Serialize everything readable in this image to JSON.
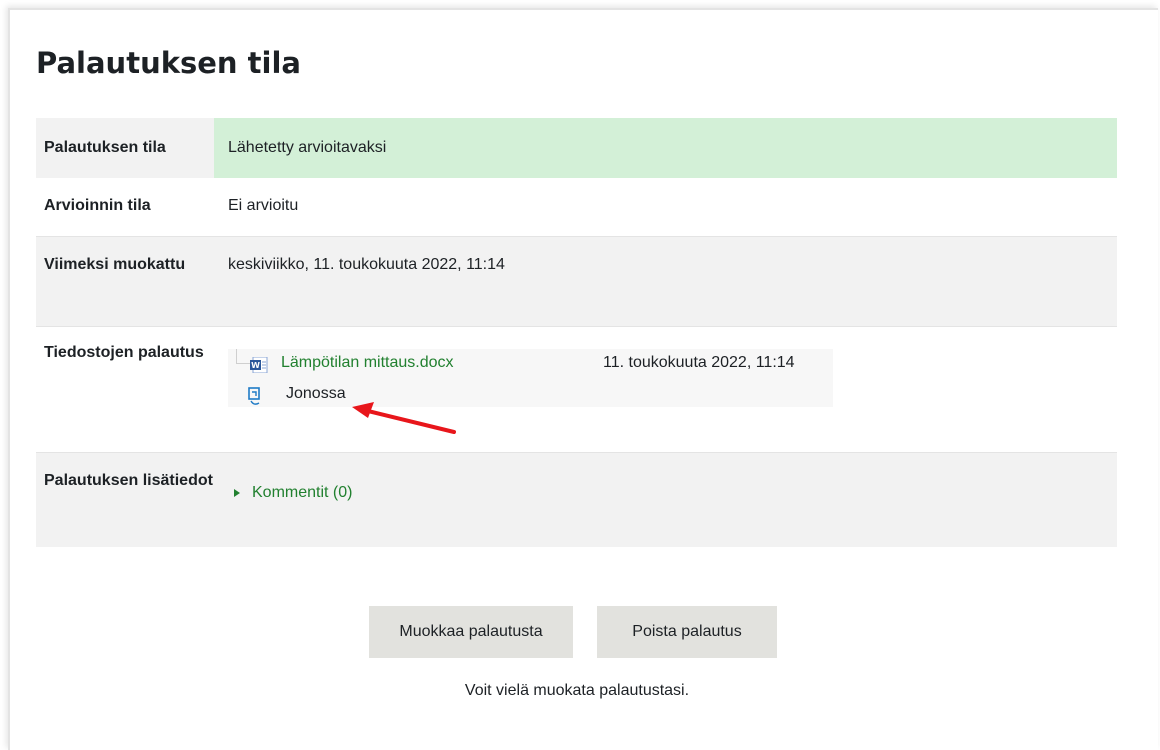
{
  "heading": "Palautuksen tila",
  "rows": {
    "submission_status": {
      "label": "Palautuksen tila",
      "value": "Lähetetty arvioitavaksi"
    },
    "grading_status": {
      "label": "Arvioinnin tila",
      "value": "Ei arvioitu"
    },
    "last_modified": {
      "label": "Viimeksi muokattu",
      "value": "keskiviikko, 11. toukokuuta 2022, 11:14"
    },
    "file_submissions": {
      "label": "Tiedostojen palautus",
      "file": {
        "name": "Lämpötilan mittaus.docx",
        "date": "11. toukokuuta 2022, 11:14",
        "icon": "word-file-icon"
      },
      "queue": {
        "label": "Jonossa",
        "icon": "queue-icon"
      }
    },
    "submission_comments": {
      "label": "Palautuksen lisätiedot",
      "link": "Kommentit (0)"
    }
  },
  "buttons": {
    "edit": "Muokkaa palautusta",
    "remove": "Poista palautus"
  },
  "hint": "Voit vielä muokata palautustasi.",
  "colors": {
    "success_bg": "#d3f0d7",
    "link": "#21802f",
    "annotation_arrow": "#e8161b",
    "button_bg": "#e2e2de"
  }
}
